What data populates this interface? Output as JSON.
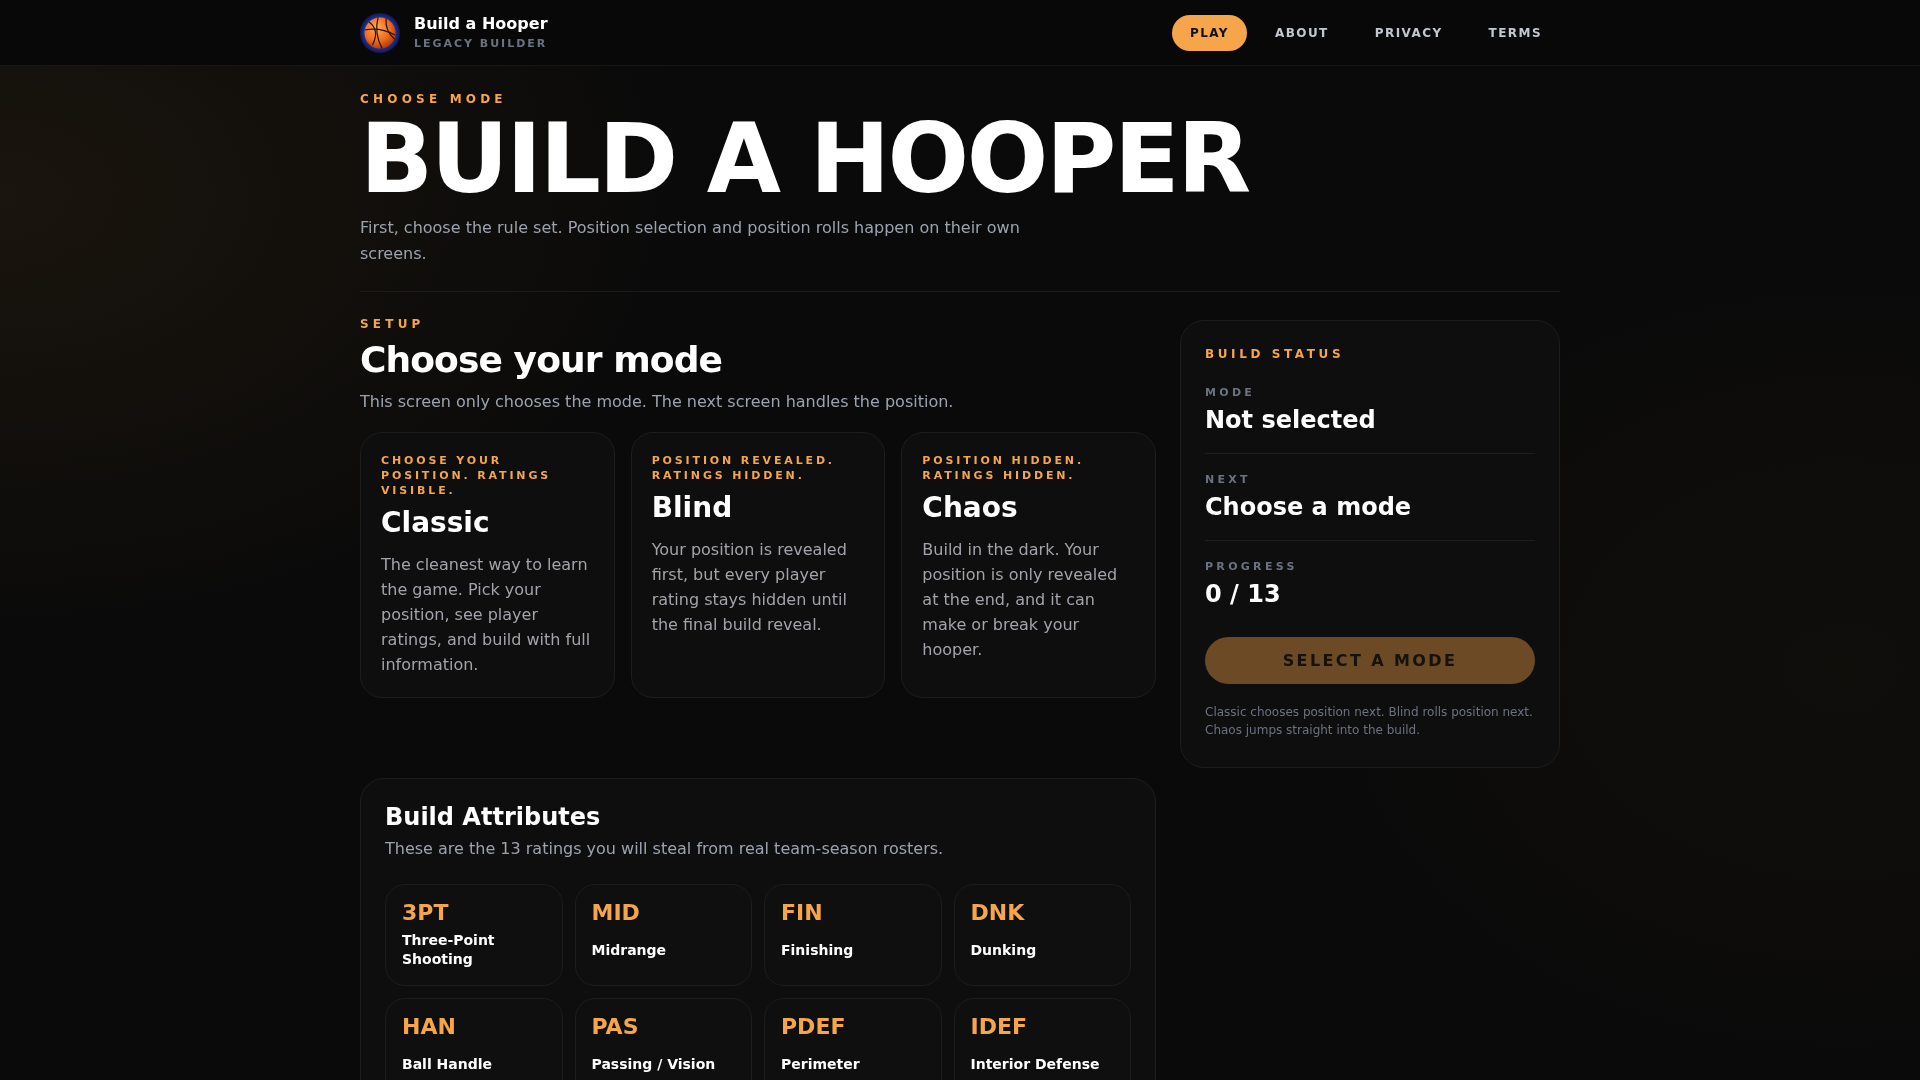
{
  "header": {
    "brand": {
      "title": "Build a Hooper",
      "subtitle": "LEGACY BUILDER"
    },
    "nav": [
      {
        "label": "PLAY",
        "selected": true
      },
      {
        "label": "ABOUT",
        "selected": false
      },
      {
        "label": "PRIVACY",
        "selected": false
      },
      {
        "label": "TERMS",
        "selected": false
      }
    ]
  },
  "hero": {
    "eyebrow": "CHOOSE MODE",
    "title": "BUILD A HOOPER",
    "description": "First, choose the rule set. Position selection and position rolls happen on their own screens."
  },
  "setup": {
    "eyebrow": "SETUP",
    "title": "Choose your mode",
    "description": "This screen only chooses the mode. The next screen handles the position.",
    "modes": [
      {
        "tag": "CHOOSE YOUR POSITION. RATINGS VISIBLE.",
        "name": "Classic",
        "description": "The cleanest way to learn the game. Pick your position, see player ratings, and build with full information.",
        "selected": false
      },
      {
        "tag": "POSITION REVEALED. RATINGS HIDDEN.",
        "name": "Blind",
        "description": "Your position is revealed first, but every player rating stays hidden until the final build reveal.",
        "selected": false
      },
      {
        "tag": "POSITION HIDDEN. RATINGS HIDDEN.",
        "name": "Chaos",
        "description": "Build in the dark. Your position is only revealed at the end, and it can make or break your hooper.",
        "selected": false
      }
    ]
  },
  "build_status": {
    "eyebrow": "BUILD STATUS",
    "fields": [
      {
        "label": "MODE",
        "value": "Not selected"
      },
      {
        "label": "NEXT",
        "value": "Choose a mode"
      },
      {
        "label": "PROGRESS",
        "value": "0 / 13"
      }
    ],
    "button": {
      "label": "SELECT A MODE",
      "disabled": true
    },
    "note": "Classic chooses position next. Blind rolls position next. Chaos jumps straight into the build."
  },
  "attributes": {
    "title": "Build Attributes",
    "description": "These are the 13 ratings you will steal from real team-season rosters.",
    "items": [
      {
        "code": "3PT",
        "name": "Three-Point Shooting"
      },
      {
        "code": "MID",
        "name": "Midrange"
      },
      {
        "code": "FIN",
        "name": "Finishing"
      },
      {
        "code": "DNK",
        "name": "Dunking"
      },
      {
        "code": "HAN",
        "name": "Ball Handle"
      },
      {
        "code": "PAS",
        "name": "Passing / Vision"
      },
      {
        "code": "PDEF",
        "name": "Perimeter"
      },
      {
        "code": "IDEF",
        "name": "Interior Defense"
      }
    ]
  }
}
